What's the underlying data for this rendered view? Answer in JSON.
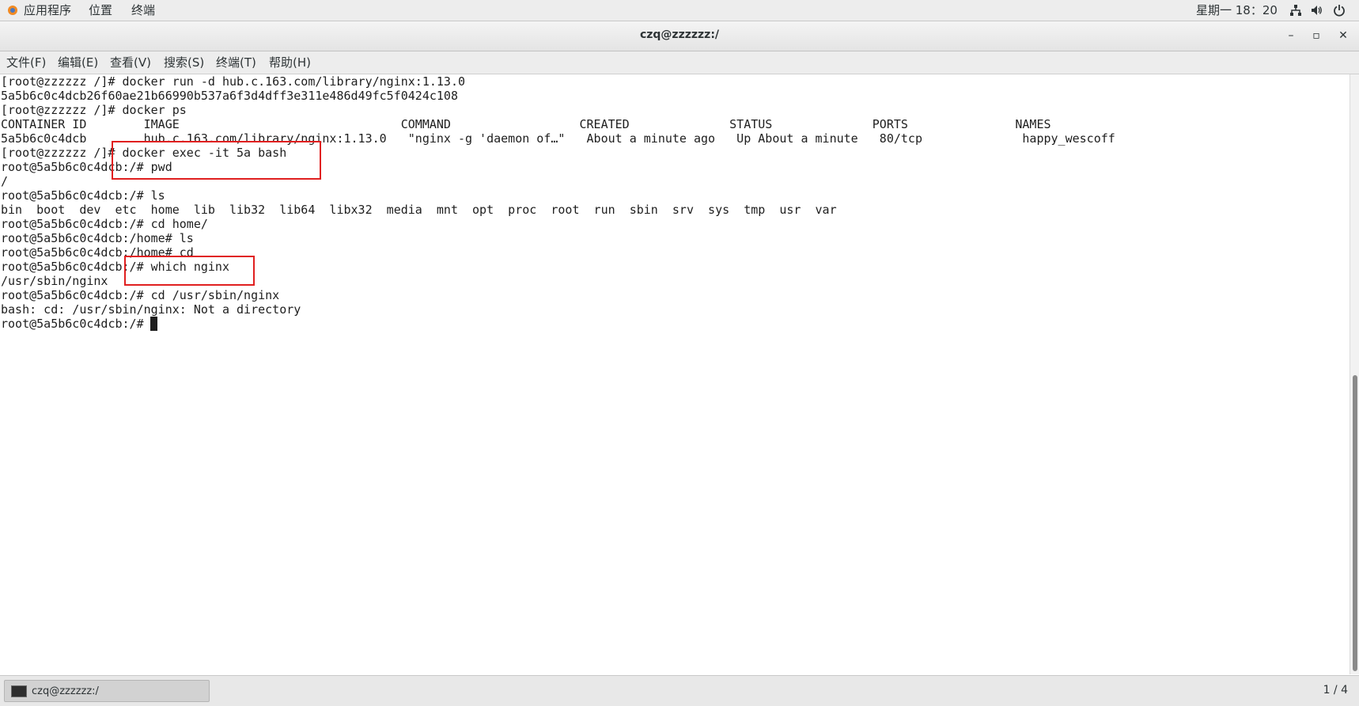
{
  "topbar": {
    "apps": "应用程序",
    "places": "位置",
    "terminal": "终端",
    "clock": "星期一 18：20",
    "icons": [
      "apps-icon",
      "network-icon",
      "volume-icon",
      "power-icon"
    ]
  },
  "window": {
    "title": "czq@zzzzzz:/",
    "minimize": "–",
    "maximize": "▫",
    "close": "✕"
  },
  "menu": {
    "file": "文件(F)",
    "edit": "编辑(E)",
    "view": "查看(V)",
    "search": "搜索(S)",
    "terminal": "终端(T)",
    "help": "帮助(H)"
  },
  "terminal": {
    "lines": [
      "[root@zzzzzz /]# docker run -d hub.c.163.com/library/nginx:1.13.0",
      "5a5b6c0c4dcb26f60ae21b66990b537a6f3d4dff3e311e486d49fc5f0424c108",
      "[root@zzzzzz /]# docker ps",
      "CONTAINER ID        IMAGE                               COMMAND                  CREATED              STATUS              PORTS               NAMES",
      "5a5b6c0c4dcb        hub.c.163.com/library/nginx:1.13.0   \"nginx -g 'daemon of…\"   About a minute ago   Up About a minute   80/tcp              happy_wescoff",
      "[root@zzzzzz /]# docker exec -it 5a bash",
      "root@5a5b6c0c4dcb:/# pwd",
      "/",
      "root@5a5b6c0c4dcb:/# ls",
      "bin  boot  dev  etc  home  lib  lib32  lib64  libx32  media  mnt  opt  proc  root  run  sbin  srv  sys  tmp  usr  var",
      "root@5a5b6c0c4dcb:/# cd home/",
      "root@5a5b6c0c4dcb:/home# ls",
      "root@5a5b6c0c4dcb:/home# cd",
      "root@5a5b6c0c4dcb:/# which nginx",
      "/usr/sbin/nginx",
      "root@5a5b6c0c4dcb:/# cd /usr/sbin/nginx",
      "bash: cd: /usr/sbin/nginx: Not a directory",
      "root@5a5b6c0c4dcb:/# "
    ]
  },
  "taskbar": {
    "task_label": "czq@zzzzzz:/",
    "workspace": "1 / 4"
  },
  "colors": {
    "highlight": "#e02020",
    "terminal_bg": "#ffffff",
    "terminal_fg": "#1e1e1e"
  }
}
